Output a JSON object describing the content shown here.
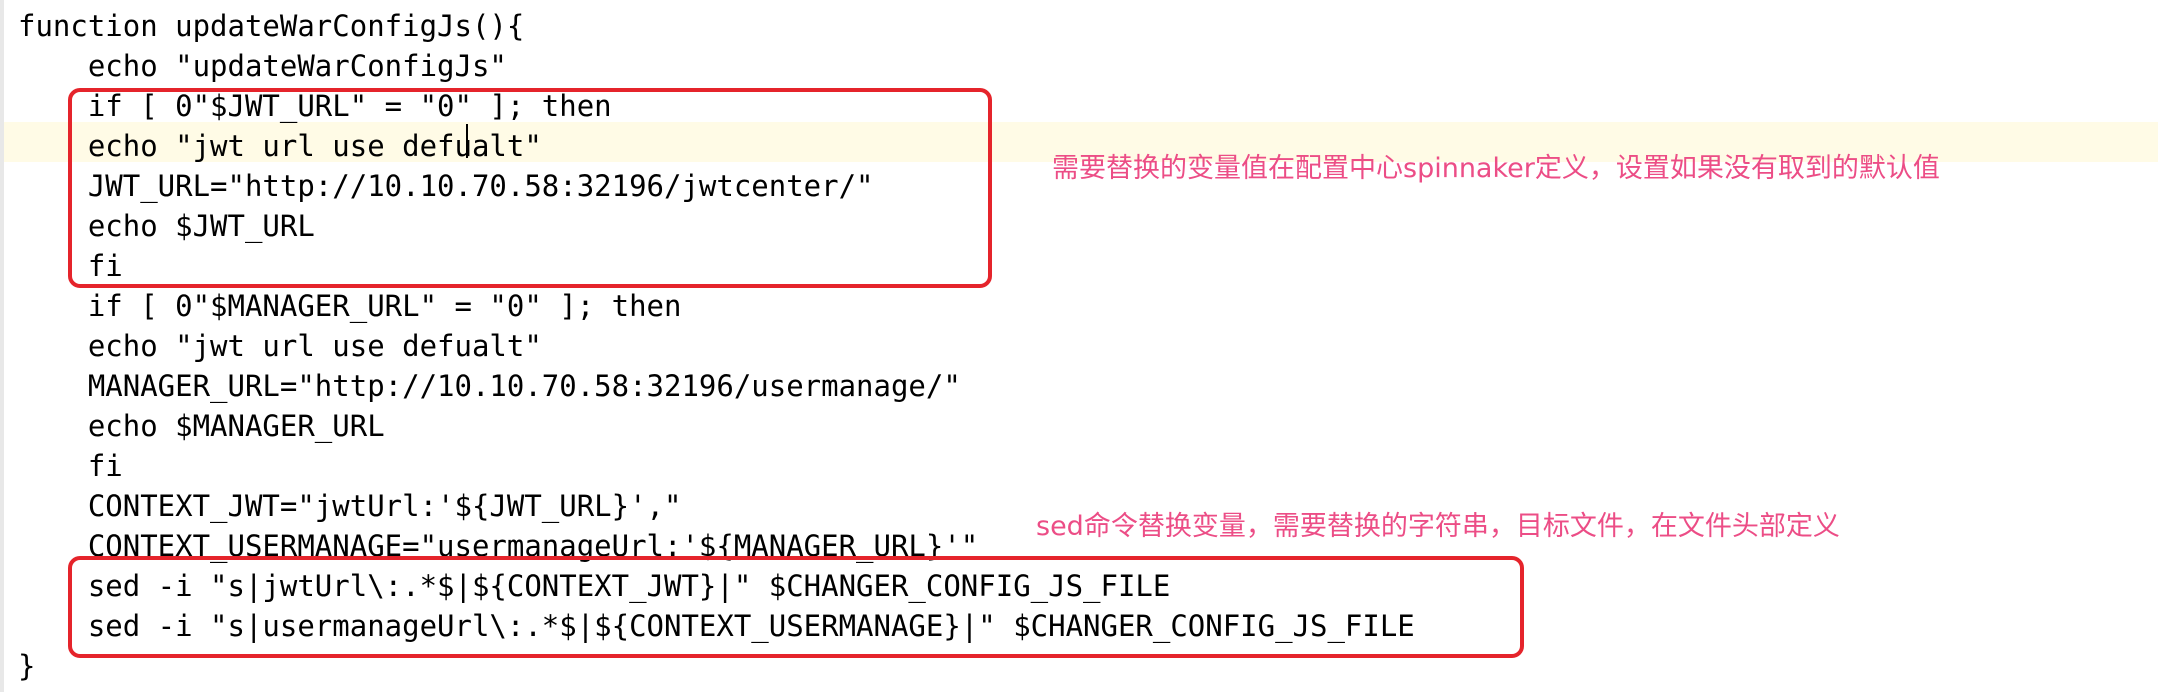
{
  "code_lines": [
    "function updateWarConfigJs(){",
    "    echo \"updateWarConfigJs\"",
    "    if [ 0\"$JWT_URL\" = \"0\" ]; then",
    "    echo \"jwt url use defualt\"",
    "    JWT_URL=\"http://10.10.70.58:32196/jwtcenter/\"",
    "    echo $JWT_URL",
    "    fi",
    "    if [ 0\"$MANAGER_URL\" = \"0\" ]; then",
    "    echo \"jwt url use defualt\"",
    "    MANAGER_URL=\"http://10.10.70.58:32196/usermanage/\"",
    "    echo $MANAGER_URL",
    "    fi",
    "    CONTEXT_JWT=\"jwtUrl:'${JWT_URL}',\"",
    "    CONTEXT_USERMANAGE=\"usermanageUrl:'${MANAGER_URL}'\"",
    "    sed -i \"s|jwtUrl\\:.*$|${CONTEXT_JWT}|\" $CHANGER_CONFIG_JS_FILE",
    "    sed -i \"s|usermanageUrl\\:.*$|${CONTEXT_USERMANAGE}|\" $CHANGER_CONFIG_JS_FILE",
    "}"
  ],
  "annotations": {
    "note_1": "需要替换的变量值在配置中心spinnaker定义，设置如果没有取到的默认值",
    "note_2": "sed命令替换变量，需要替换的字符串，目标文件，在文件头部定义"
  },
  "colors": {
    "box_border": "#e5242b",
    "note_text": "#ec4d86",
    "current_line_highlight": "#fffbe6"
  }
}
